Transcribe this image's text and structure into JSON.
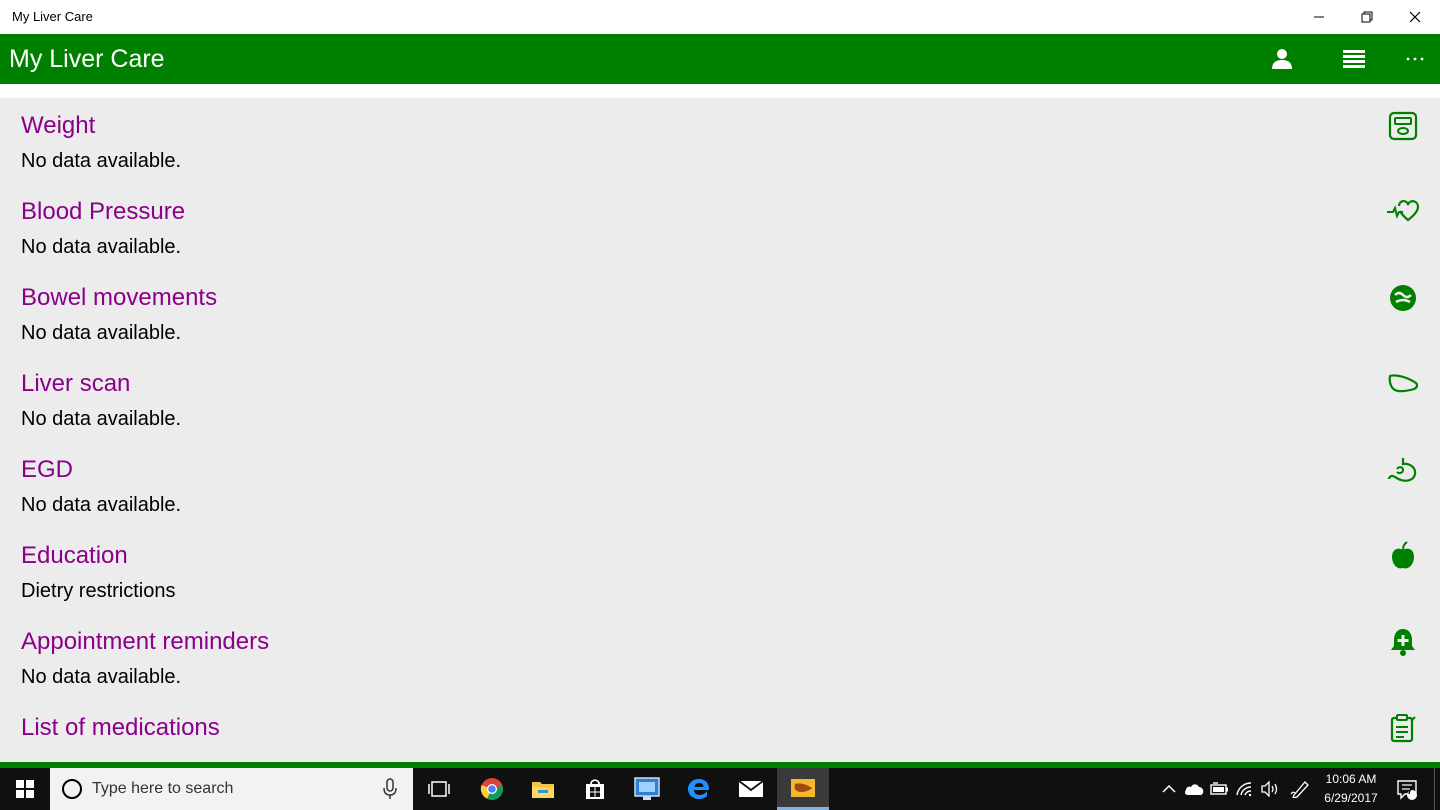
{
  "window": {
    "title": "My Liver Care",
    "minimize_icon": "minimize-icon",
    "restore_icon": "restore-icon",
    "close_icon": "close-icon"
  },
  "appbar": {
    "title": "My Liver Care",
    "background": "#008000",
    "actions": [
      "profile-icon",
      "list-view-icon",
      "more-icon"
    ]
  },
  "items": [
    {
      "title": "Weight",
      "subtitle": "No data available.",
      "icon": "scale-icon"
    },
    {
      "title": "Blood Pressure",
      "subtitle": "No data available.",
      "icon": "heart-pulse-icon"
    },
    {
      "title": "Bowel movements",
      "subtitle": "No data available.",
      "icon": "bowel-icon"
    },
    {
      "title": "Liver scan",
      "subtitle": "No data available.",
      "icon": "liver-icon"
    },
    {
      "title": "EGD",
      "subtitle": "No data available.",
      "icon": "stomach-icon"
    },
    {
      "title": "Education",
      "subtitle": "Dietry restrictions",
      "icon": "apple-icon"
    },
    {
      "title": "Appointment reminders",
      "subtitle": "No data available.",
      "icon": "bell-plus-icon"
    },
    {
      "title": "List of medications",
      "subtitle": "",
      "icon": "prescription-icon"
    }
  ],
  "colors": {
    "accent": "#008000",
    "item_title": "#8b008b",
    "content_bg": "#ececec"
  },
  "taskbar": {
    "search_placeholder": "Type here to search",
    "apps": [
      "task-view-icon",
      "chrome-icon",
      "file-explorer-icon",
      "store-icon",
      "remote-desktop-icon",
      "edge-icon",
      "mail-icon",
      "my-liver-care-app-icon"
    ],
    "tray": [
      "chevron-up-icon",
      "onedrive-icon",
      "battery-icon",
      "wifi-icon",
      "volume-icon",
      "pen-icon"
    ],
    "time": "10:06 AM",
    "date": "6/29/2017",
    "notification_count": "7"
  }
}
